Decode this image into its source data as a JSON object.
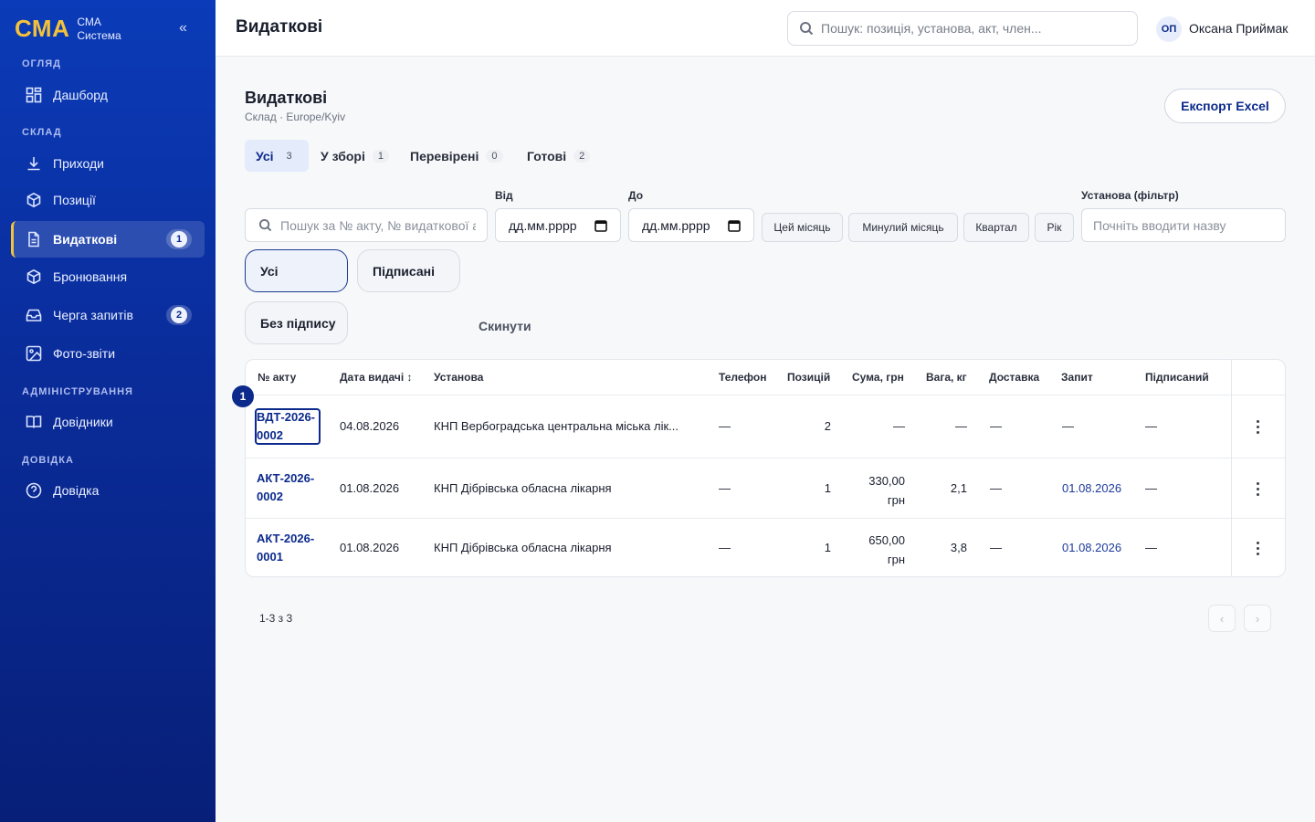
{
  "brand": {
    "logo": "СМА",
    "line1": "СМА",
    "line2": "Система",
    "collapse": "«"
  },
  "sidebar": {
    "sections": [
      {
        "label": "ОГЛЯД"
      },
      {
        "label": "СКЛАД"
      },
      {
        "label": "АДМІНІСТРУВАННЯ"
      },
      {
        "label": "ДОВІДКА"
      }
    ],
    "items": [
      {
        "label": "Дашборд",
        "icon": "dashboard-icon"
      },
      {
        "label": "Приходи",
        "icon": "download-icon"
      },
      {
        "label": "Позиції",
        "icon": "box-icon"
      },
      {
        "label": "Видаткові",
        "icon": "document-icon",
        "badge": "1"
      },
      {
        "label": "Бронювання",
        "icon": "box-icon"
      },
      {
        "label": "Черга запитів",
        "icon": "inbox-icon",
        "badge": "2"
      },
      {
        "label": "Фото-звіти",
        "icon": "image-icon"
      },
      {
        "label": "Довідники",
        "icon": "book-icon"
      },
      {
        "label": "Довідка",
        "icon": "help-icon"
      }
    ]
  },
  "topbar": {
    "title": "Видаткові",
    "search_placeholder": "Пошук: позиція, установа, акт, член...",
    "user_initials": "ОП",
    "user_name": "Оксана Приймак"
  },
  "page": {
    "title": "Видаткові",
    "subtitle": "Склад · Europe/Kyiv",
    "export_label": "Експорт Excel"
  },
  "tabs": [
    {
      "label": "Усі",
      "count": "3"
    },
    {
      "label": "У зборі",
      "count": "1"
    },
    {
      "label": "Перевірені",
      "count": "0"
    },
    {
      "label": "Готові",
      "count": "2"
    }
  ],
  "filters": {
    "search_placeholder": "Пошук за № акту, № видаткової або ...",
    "from_label": "Від",
    "to_label": "До",
    "date_placeholder": "дд.мм.рррр",
    "quick": [
      "Цей місяць",
      "Минулий місяць",
      "Квартал",
      "Рік"
    ],
    "institution_label": "Установа (фільтр)",
    "institution_placeholder": "Почніть вводити назву",
    "sign": [
      "Усі",
      "Підписані",
      "Без підпису"
    ],
    "reset_label": "Скинути"
  },
  "table": {
    "columns": [
      "№ акту",
      "Дата видачі ↕",
      "Установа",
      "Телефон",
      "Позицій",
      "Сума, грн",
      "Вага, кг",
      "Доставка",
      "Запит",
      "Підписаний"
    ],
    "rows": [
      {
        "act": "ВДТ-2026-\n0002",
        "date": "04.08.2026",
        "institution": "КНП Вербоградська центральна міська лік...",
        "phone": "—",
        "positions": "2",
        "sum1": "—",
        "sum2": "",
        "weight": "—",
        "delivery": "—",
        "request": "—",
        "signed": "—"
      },
      {
        "act": "АКТ-2026-\n0002",
        "date": "01.08.2026",
        "institution": "КНП Дібрівська обласна лікарня",
        "phone": "—",
        "positions": "1",
        "sum1": "330,00",
        "sum2": "грн",
        "weight": "2,1",
        "delivery": "—",
        "request": "01.08.2026",
        "signed": "—"
      },
      {
        "act": "АКТ-2026-\n0001",
        "date": "01.08.2026",
        "institution": "КНП Дібрівська обласна лікарня",
        "phone": "—",
        "positions": "1",
        "sum1": "650,00",
        "sum2": "грн",
        "weight": "3,8",
        "delivery": "—",
        "request": "01.08.2026",
        "signed": "—"
      }
    ]
  },
  "step_badge": "1",
  "pager": {
    "info": "1-3 з 3",
    "prev": "‹",
    "next": "›"
  }
}
